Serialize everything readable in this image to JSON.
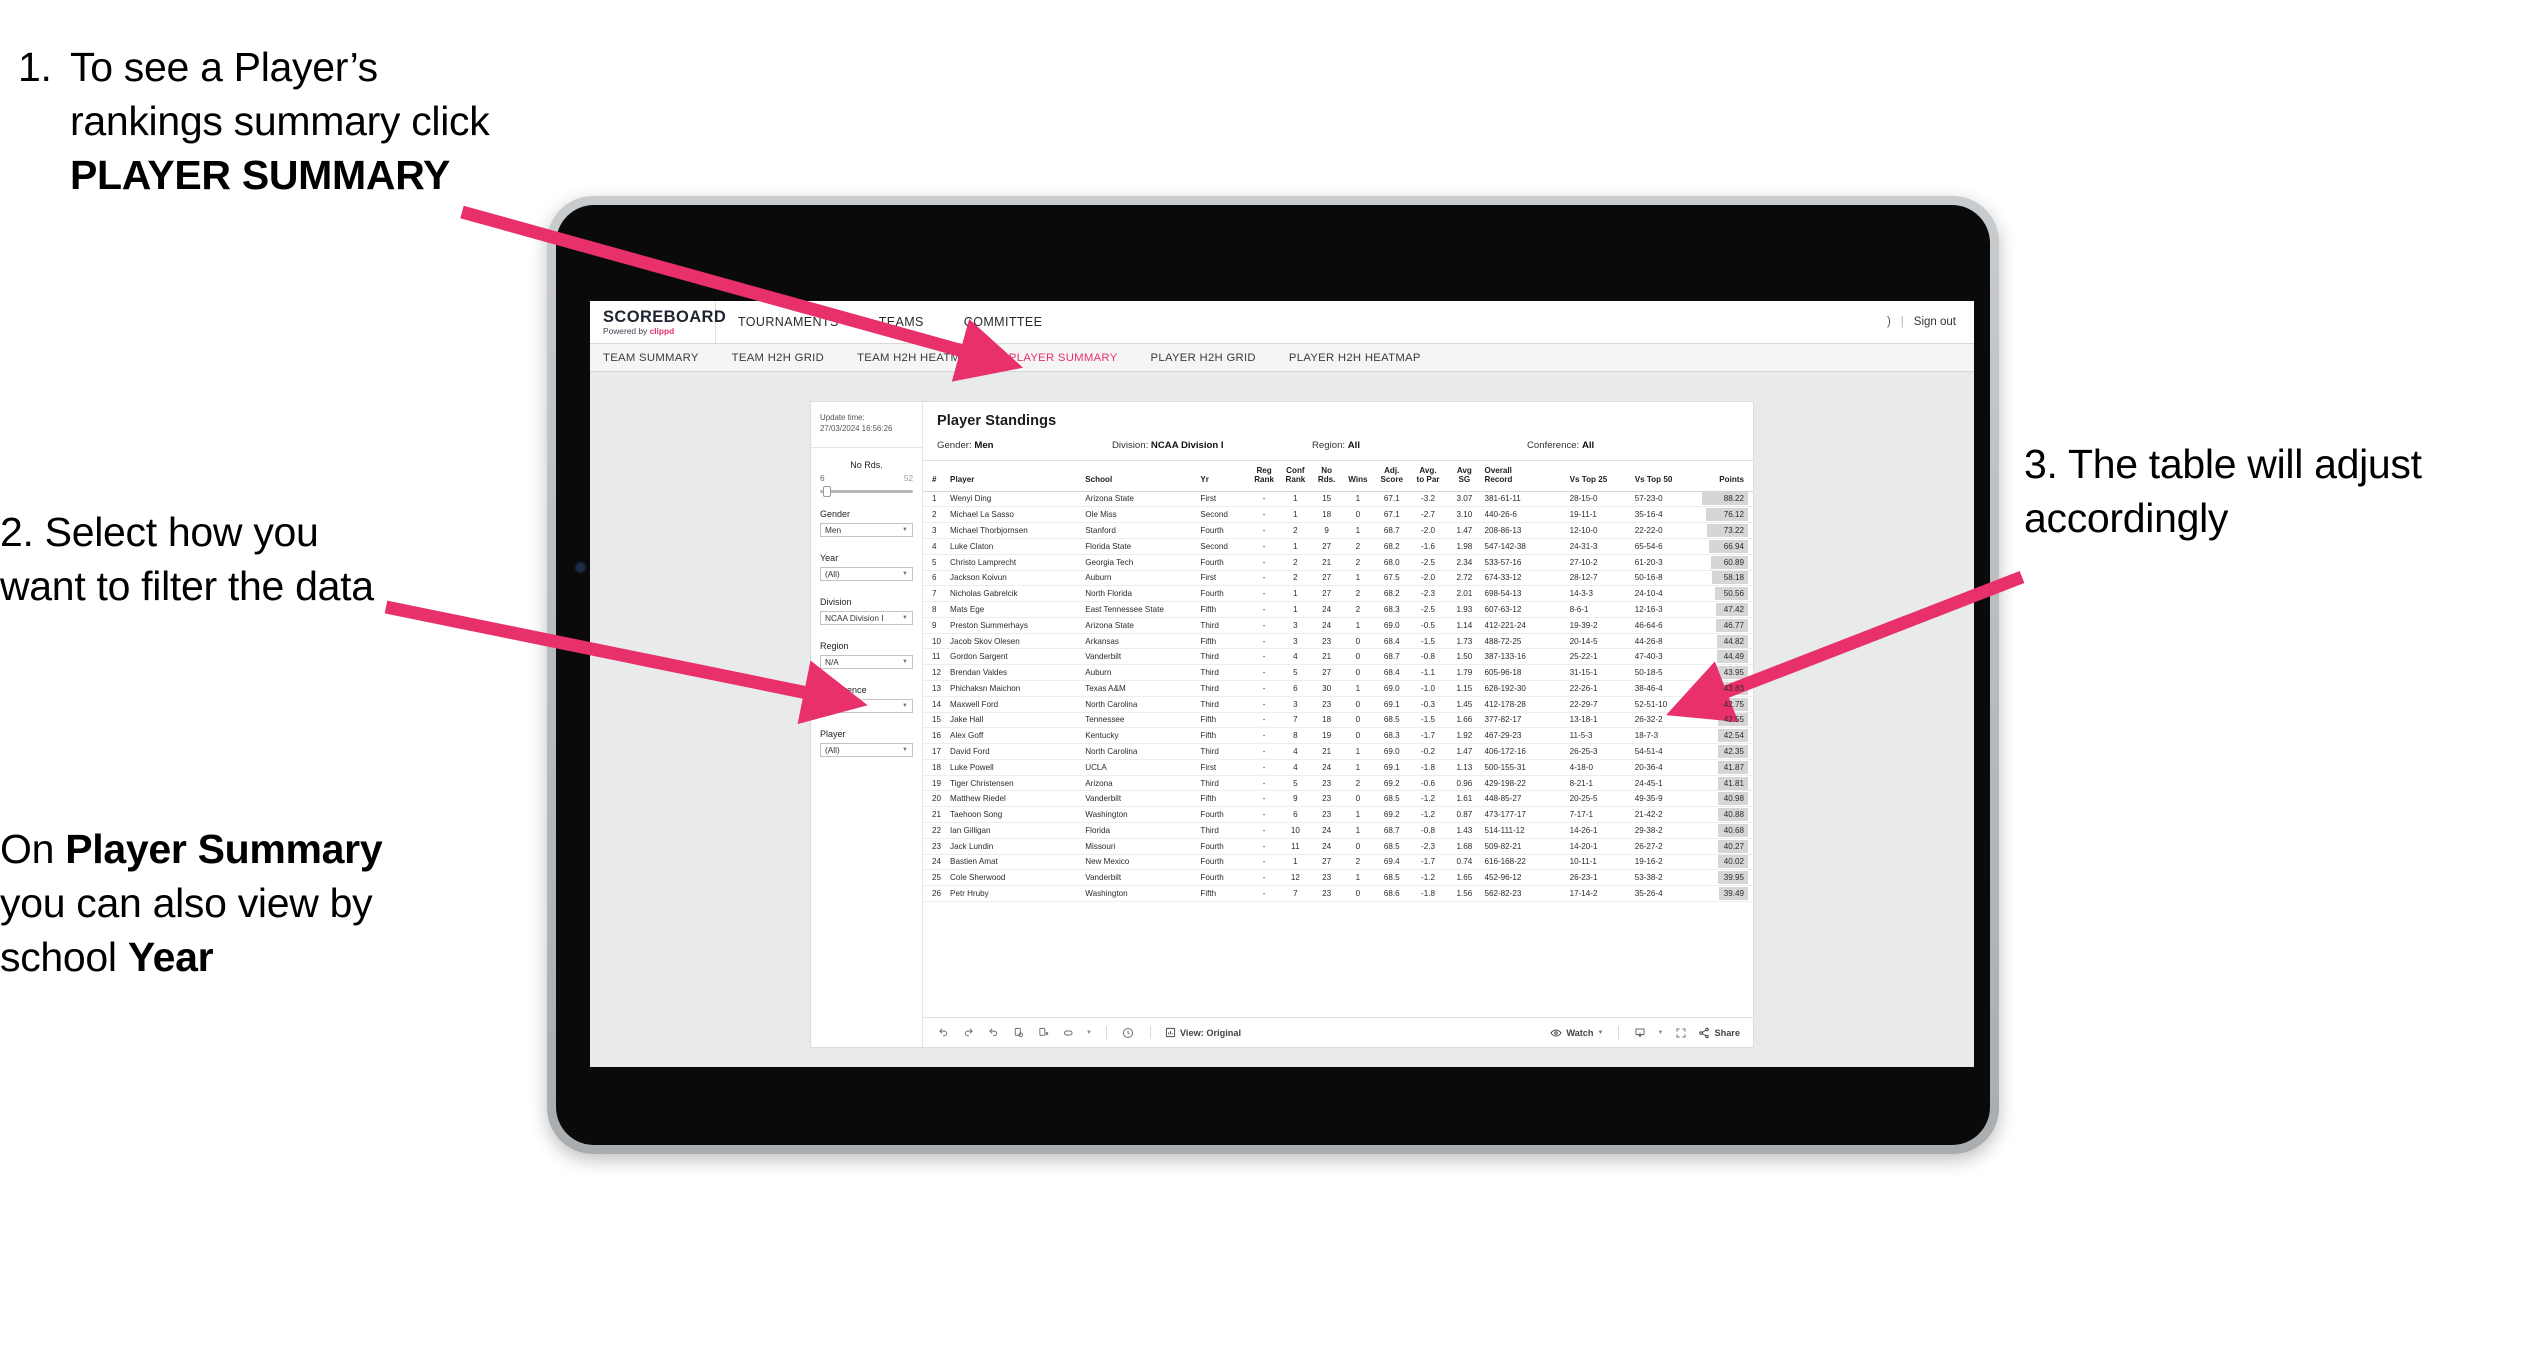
{
  "annotations": {
    "step1_number": "1.",
    "step1_text_a": "To see a Player’s rankings summary click ",
    "step1_bold": "PLAYER SUMMARY",
    "step2": "2. Select how you want to filter the data",
    "step3_pre": "On ",
    "step3_bold1": "Player Summary",
    "step3_mid": " you can also view by school ",
    "step3_bold2": "Year",
    "step4": "3. The table will adjust accordingly"
  },
  "app": {
    "logo_main": "SCOREBOARD",
    "logo_sub_prefix": "Powered by ",
    "logo_sub_brand": "clippd",
    "main_nav": [
      "TOURNAMENTS",
      "TEAMS",
      "COMMITTEE"
    ],
    "header_right": {
      "account_partial": ")",
      "separator": "|",
      "sign_out": "Sign out"
    },
    "sub_nav": [
      {
        "label": "TEAM SUMMARY",
        "active": false
      },
      {
        "label": "TEAM H2H GRID",
        "active": false
      },
      {
        "label": "TEAM H2H HEATMAP",
        "active": false
      },
      {
        "label": "PLAYER SUMMARY",
        "active": true
      },
      {
        "label": "PLAYER H2H GRID",
        "active": false
      },
      {
        "label": "PLAYER H2H HEATMAP",
        "active": false
      }
    ],
    "accent_color": "#e8306b"
  },
  "viz": {
    "update_time_label": "Update time:",
    "update_time_value": "27/03/2024 16:56:26",
    "title": "Player Standings",
    "meta": {
      "gender_label": "Gender: ",
      "gender_value": "Men",
      "division_label": "Division: ",
      "division_value": "NCAA Division I",
      "region_label": "Region: ",
      "region_value": "All",
      "conference_label": "Conference: ",
      "conference_value": "All"
    },
    "filters": {
      "slider": {
        "label": "No Rds.",
        "min": "6",
        "max": "52"
      },
      "selects": [
        {
          "label": "Gender",
          "value": "Men"
        },
        {
          "label": "Year",
          "value": "(All)"
        },
        {
          "label": "Division",
          "value": "NCAA Division I"
        },
        {
          "label": "Region",
          "value": "N/A"
        },
        {
          "label": "Conference",
          "value": "(All)"
        },
        {
          "label": "Player",
          "value": "(All)"
        }
      ]
    },
    "toolbar": {
      "view_label": "View: Original",
      "watch_label": "Watch",
      "share_label": "Share"
    }
  },
  "chart_data": {
    "type": "table",
    "title": "Player Standings",
    "columns": [
      "#",
      "Player",
      "School",
      "Yr",
      "Reg Rank",
      "Conf Rank",
      "No Rds.",
      "Wins",
      "Adj. Score",
      "Avg. to Par",
      "Avg SG",
      "Overall Record",
      "Vs Top 25",
      "Vs Top 50",
      "Points"
    ],
    "column_headers_wrapped": [
      {
        "l1": "#",
        "l2": ""
      },
      {
        "l1": "Player",
        "l2": ""
      },
      {
        "l1": "School",
        "l2": ""
      },
      {
        "l1": "Yr",
        "l2": ""
      },
      {
        "l1": "Reg",
        "l2": "Rank"
      },
      {
        "l1": "Conf",
        "l2": "Rank"
      },
      {
        "l1": "No",
        "l2": "Rds."
      },
      {
        "l1": "",
        "l2": "Wins"
      },
      {
        "l1": "Adj.",
        "l2": "Score"
      },
      {
        "l1": "Avg.",
        "l2": "to Par"
      },
      {
        "l1": "Avg",
        "l2": "SG"
      },
      {
        "l1": "Overall",
        "l2": "Record"
      },
      {
        "l1": "",
        "l2": "Vs Top 25"
      },
      {
        "l1": "",
        "l2": "Vs Top 50"
      },
      {
        "l1": "",
        "l2": "Points"
      }
    ],
    "points_max": 88.22,
    "rows": [
      {
        "rank": "1",
        "player": "Wenyi Ding",
        "school": "Arizona State",
        "yr": "First",
        "reg": "-",
        "conf": "1",
        "rds": "15",
        "wins": "1",
        "adj": "67.1",
        "par": "-3.2",
        "sg": "3.07",
        "record": "381-61-11",
        "t25": "28-15-0",
        "t50": "57-23-0",
        "points": "88.22"
      },
      {
        "rank": "2",
        "player": "Michael La Sasso",
        "school": "Ole Miss",
        "yr": "Second",
        "reg": "-",
        "conf": "1",
        "rds": "18",
        "wins": "0",
        "adj": "67.1",
        "par": "-2.7",
        "sg": "3.10",
        "record": "440-26-6",
        "t25": "19-11-1",
        "t50": "35-16-4",
        "points": "76.12"
      },
      {
        "rank": "3",
        "player": "Michael Thorbjornsen",
        "school": "Stanford",
        "yr": "Fourth",
        "reg": "-",
        "conf": "2",
        "rds": "9",
        "wins": "1",
        "adj": "68.7",
        "par": "-2.0",
        "sg": "1.47",
        "record": "208-86-13",
        "t25": "12-10-0",
        "t50": "22-22-0",
        "points": "73.22"
      },
      {
        "rank": "4",
        "player": "Luke Claton",
        "school": "Florida State",
        "yr": "Second",
        "reg": "-",
        "conf": "1",
        "rds": "27",
        "wins": "2",
        "adj": "68.2",
        "par": "-1.6",
        "sg": "1.98",
        "record": "547-142-38",
        "t25": "24-31-3",
        "t50": "65-54-6",
        "points": "66.94"
      },
      {
        "rank": "5",
        "player": "Christo Lamprecht",
        "school": "Georgia Tech",
        "yr": "Fourth",
        "reg": "-",
        "conf": "2",
        "rds": "21",
        "wins": "2",
        "adj": "68.0",
        "par": "-2.5",
        "sg": "2.34",
        "record": "533-57-16",
        "t25": "27-10-2",
        "t50": "61-20-3",
        "points": "60.89"
      },
      {
        "rank": "6",
        "player": "Jackson Koivun",
        "school": "Auburn",
        "yr": "First",
        "reg": "-",
        "conf": "2",
        "rds": "27",
        "wins": "1",
        "adj": "67.5",
        "par": "-2.0",
        "sg": "2.72",
        "record": "674-33-12",
        "t25": "28-12-7",
        "t50": "50-16-8",
        "points": "58.18"
      },
      {
        "rank": "7",
        "player": "Nicholas Gabrelcik",
        "school": "North Florida",
        "yr": "Fourth",
        "reg": "-",
        "conf": "1",
        "rds": "27",
        "wins": "2",
        "adj": "68.2",
        "par": "-2.3",
        "sg": "2.01",
        "record": "698-54-13",
        "t25": "14-3-3",
        "t50": "24-10-4",
        "points": "50.56"
      },
      {
        "rank": "8",
        "player": "Mats Ege",
        "school": "East Tennessee State",
        "yr": "Fifth",
        "reg": "-",
        "conf": "1",
        "rds": "24",
        "wins": "2",
        "adj": "68.3",
        "par": "-2.5",
        "sg": "1.93",
        "record": "607-63-12",
        "t25": "8-6-1",
        "t50": "12-16-3",
        "points": "47.42"
      },
      {
        "rank": "9",
        "player": "Preston Summerhays",
        "school": "Arizona State",
        "yr": "Third",
        "reg": "-",
        "conf": "3",
        "rds": "24",
        "wins": "1",
        "adj": "69.0",
        "par": "-0.5",
        "sg": "1.14",
        "record": "412-221-24",
        "t25": "19-39-2",
        "t50": "46-64-6",
        "points": "46.77"
      },
      {
        "rank": "10",
        "player": "Jacob Skov Olesen",
        "school": "Arkansas",
        "yr": "Fifth",
        "reg": "-",
        "conf": "3",
        "rds": "23",
        "wins": "0",
        "adj": "68.4",
        "par": "-1.5",
        "sg": "1.73",
        "record": "488-72-25",
        "t25": "20-14-5",
        "t50": "44-26-8",
        "points": "44.82"
      },
      {
        "rank": "11",
        "player": "Gordon Sargent",
        "school": "Vanderbilt",
        "yr": "Third",
        "reg": "-",
        "conf": "4",
        "rds": "21",
        "wins": "0",
        "adj": "68.7",
        "par": "-0.8",
        "sg": "1.50",
        "record": "387-133-16",
        "t25": "25-22-1",
        "t50": "47-40-3",
        "points": "44.49"
      },
      {
        "rank": "12",
        "player": "Brendan Valdes",
        "school": "Auburn",
        "yr": "Third",
        "reg": "-",
        "conf": "5",
        "rds": "27",
        "wins": "0",
        "adj": "68.4",
        "par": "-1.1",
        "sg": "1.79",
        "record": "605-96-18",
        "t25": "31-15-1",
        "t50": "50-18-5",
        "points": "43.95"
      },
      {
        "rank": "13",
        "player": "Phichaksn Maichon",
        "school": "Texas A&M",
        "yr": "Third",
        "reg": "-",
        "conf": "6",
        "rds": "30",
        "wins": "1",
        "adj": "69.0",
        "par": "-1.0",
        "sg": "1.15",
        "record": "628-192-30",
        "t25": "22-26-1",
        "t50": "38-46-4",
        "points": "43.83"
      },
      {
        "rank": "14",
        "player": "Maxwell Ford",
        "school": "North Carolina",
        "yr": "Third",
        "reg": "-",
        "conf": "3",
        "rds": "23",
        "wins": "0",
        "adj": "69.1",
        "par": "-0.3",
        "sg": "1.45",
        "record": "412-178-28",
        "t25": "22-29-7",
        "t50": "52-51-10",
        "points": "42.75"
      },
      {
        "rank": "15",
        "player": "Jake Hall",
        "school": "Tennessee",
        "yr": "Fifth",
        "reg": "-",
        "conf": "7",
        "rds": "18",
        "wins": "0",
        "adj": "68.5",
        "par": "-1.5",
        "sg": "1.66",
        "record": "377-82-17",
        "t25": "13-18-1",
        "t50": "26-32-2",
        "points": "42.55"
      },
      {
        "rank": "16",
        "player": "Alex Goff",
        "school": "Kentucky",
        "yr": "Fifth",
        "reg": "-",
        "conf": "8",
        "rds": "19",
        "wins": "0",
        "adj": "68.3",
        "par": "-1.7",
        "sg": "1.92",
        "record": "467-29-23",
        "t25": "11-5-3",
        "t50": "18-7-3",
        "points": "42.54"
      },
      {
        "rank": "17",
        "player": "David Ford",
        "school": "North Carolina",
        "yr": "Third",
        "reg": "-",
        "conf": "4",
        "rds": "21",
        "wins": "1",
        "adj": "69.0",
        "par": "-0.2",
        "sg": "1.47",
        "record": "406-172-16",
        "t25": "26-25-3",
        "t50": "54-51-4",
        "points": "42.35"
      },
      {
        "rank": "18",
        "player": "Luke Powell",
        "school": "UCLA",
        "yr": "First",
        "reg": "-",
        "conf": "4",
        "rds": "24",
        "wins": "1",
        "adj": "69.1",
        "par": "-1.8",
        "sg": "1.13",
        "record": "500-155-31",
        "t25": "4-18-0",
        "t50": "20-36-4",
        "points": "41.87"
      },
      {
        "rank": "19",
        "player": "Tiger Christensen",
        "school": "Arizona",
        "yr": "Third",
        "reg": "-",
        "conf": "5",
        "rds": "23",
        "wins": "2",
        "adj": "69.2",
        "par": "-0.6",
        "sg": "0.96",
        "record": "429-198-22",
        "t25": "8-21-1",
        "t50": "24-45-1",
        "points": "41.81"
      },
      {
        "rank": "20",
        "player": "Matthew Riedel",
        "school": "Vanderbilt",
        "yr": "Fifth",
        "reg": "-",
        "conf": "9",
        "rds": "23",
        "wins": "0",
        "adj": "68.5",
        "par": "-1.2",
        "sg": "1.61",
        "record": "448-85-27",
        "t25": "20-25-5",
        "t50": "49-35-9",
        "points": "40.98"
      },
      {
        "rank": "21",
        "player": "Taehoon Song",
        "school": "Washington",
        "yr": "Fourth",
        "reg": "-",
        "conf": "6",
        "rds": "23",
        "wins": "1",
        "adj": "69.2",
        "par": "-1.2",
        "sg": "0.87",
        "record": "473-177-17",
        "t25": "7-17-1",
        "t50": "21-42-2",
        "points": "40.88"
      },
      {
        "rank": "22",
        "player": "Ian Gilligan",
        "school": "Florida",
        "yr": "Third",
        "reg": "-",
        "conf": "10",
        "rds": "24",
        "wins": "1",
        "adj": "68.7",
        "par": "-0.8",
        "sg": "1.43",
        "record": "514-111-12",
        "t25": "14-26-1",
        "t50": "29-38-2",
        "points": "40.68"
      },
      {
        "rank": "23",
        "player": "Jack Lundin",
        "school": "Missouri",
        "yr": "Fourth",
        "reg": "-",
        "conf": "11",
        "rds": "24",
        "wins": "0",
        "adj": "68.5",
        "par": "-2.3",
        "sg": "1.68",
        "record": "509-82-21",
        "t25": "14-20-1",
        "t50": "26-27-2",
        "points": "40.27"
      },
      {
        "rank": "24",
        "player": "Bastien Amat",
        "school": "New Mexico",
        "yr": "Fourth",
        "reg": "-",
        "conf": "1",
        "rds": "27",
        "wins": "2",
        "adj": "69.4",
        "par": "-1.7",
        "sg": "0.74",
        "record": "616-168-22",
        "t25": "10-11-1",
        "t50": "19-16-2",
        "points": "40.02"
      },
      {
        "rank": "25",
        "player": "Cole Sherwood",
        "school": "Vanderbilt",
        "yr": "Fourth",
        "reg": "-",
        "conf": "12",
        "rds": "23",
        "wins": "1",
        "adj": "68.5",
        "par": "-1.2",
        "sg": "1.65",
        "record": "452-96-12",
        "t25": "26-23-1",
        "t50": "53-38-2",
        "points": "39.95"
      },
      {
        "rank": "26",
        "player": "Petr Hruby",
        "school": "Washington",
        "yr": "Fifth",
        "reg": "-",
        "conf": "7",
        "rds": "23",
        "wins": "0",
        "adj": "68.6",
        "par": "-1.8",
        "sg": "1.56",
        "record": "562-82-23",
        "t25": "17-14-2",
        "t50": "35-26-4",
        "points": "39.49"
      }
    ]
  }
}
